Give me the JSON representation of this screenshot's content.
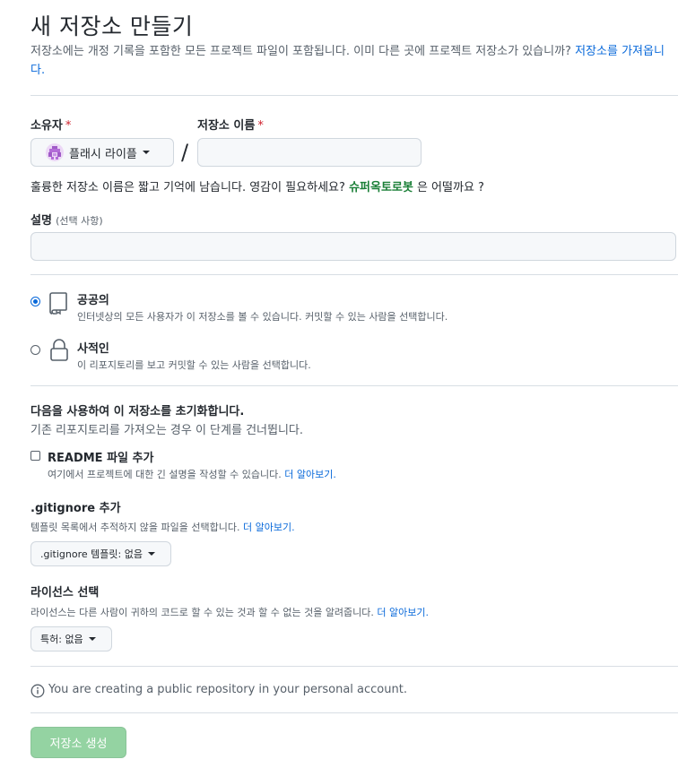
{
  "page": {
    "title": "새 저장소 만들기",
    "intro": "저장소에는 개정 기록을 포함한 모든 프로젝트 파일이 포함됩니다. 이미 다른 곳에 프로젝트 저장소가 있습니까?",
    "import_link": "저장소를 가져옵니다."
  },
  "owner": {
    "label": "소유자",
    "required_mark": "*",
    "selected": "플래시 라이플"
  },
  "repo_name": {
    "label": "저장소 이름",
    "required_mark": "*",
    "value": ""
  },
  "name_hint": {
    "text": "훌륭한 저장소 이름은 짧고 기억에 남습니다. 영감이 필요하세요?",
    "suggestion": "슈퍼옥토로봇",
    "suffix": "은 어떨까요 ?"
  },
  "description": {
    "label": "설명",
    "optional": "(선택 사항)",
    "value": ""
  },
  "visibility": {
    "public": {
      "title": "공공의",
      "desc": "인터넷상의 모든 사용자가 이 저장소를 볼 수 있습니다. 커밋할 수 있는 사람을 선택합니다.",
      "checked": true,
      "icon": "repo-icon"
    },
    "private": {
      "title": "사적인",
      "desc": "이 리포지토리를 보고 커밋할 수 있는 사람을 선택합니다.",
      "checked": false,
      "icon": "lock-icon"
    }
  },
  "init": {
    "title": "다음을 사용하여 이 저장소를 초기화합니다.",
    "subtitle": "기존 리포지토리를 가져오는 경우 이 단계를 건너뜁니다.",
    "readme": {
      "label": "README 파일 추가",
      "desc": "여기에서 프로젝트에 대한 긴 설명을 작성할 수 있습니다.",
      "learn_more": "더 알아보기.",
      "checked": false
    }
  },
  "gitignore": {
    "title": ".gitignore 추가",
    "desc": "템플릿 목록에서 추적하지 않을 파일을 선택합니다.",
    "learn_more": "더 알아보기.",
    "select": ".gitignore 템플릿: 없음"
  },
  "license": {
    "title": "라이선스 선택",
    "desc": "라이선스는 다른 사람이 귀하의 코드로 할 수 있는 것과 할 수 없는 것을 알려줍니다.",
    "learn_more": "더 알아보기.",
    "select": "특허: 없음"
  },
  "notice": {
    "text": "You are creating a public repository in your personal account.",
    "icon": "info-icon"
  },
  "submit": {
    "label": "저장소 생성",
    "enabled": false
  },
  "colors": {
    "link": "#0969da",
    "required": "#cf222e",
    "suggestion": "#1a7f37",
    "create_disabled": "#94d3a2",
    "avatar": "#ecd8f6"
  }
}
